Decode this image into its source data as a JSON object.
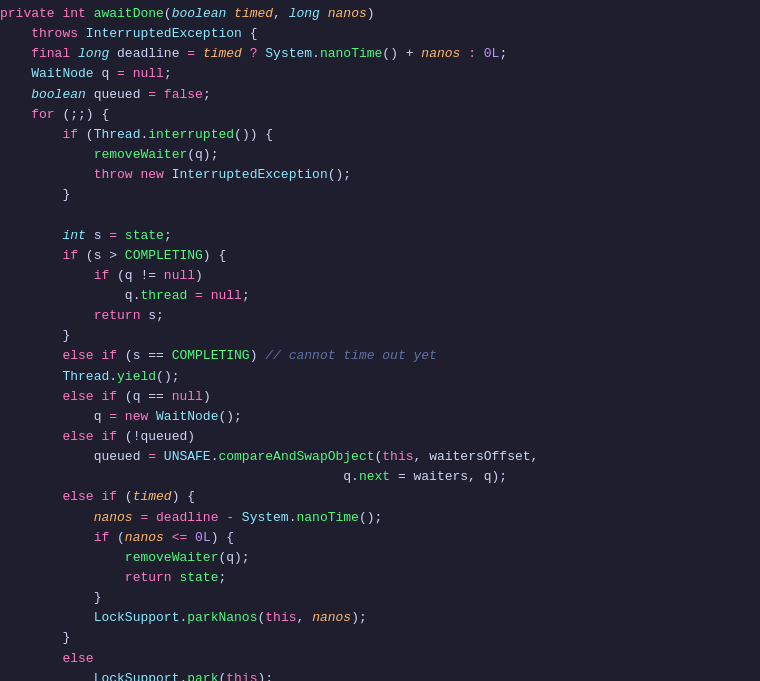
{
  "code": {
    "lines": [
      {
        "id": 1,
        "tokens": [
          {
            "text": "private ",
            "cls": "kw"
          },
          {
            "text": "int ",
            "cls": "kw"
          },
          {
            "text": "awaitDone",
            "cls": "method"
          },
          {
            "text": "(",
            "cls": "punct"
          },
          {
            "text": "boolean ",
            "cls": "type"
          },
          {
            "text": "timed",
            "cls": "param"
          },
          {
            "text": ", ",
            "cls": "punct"
          },
          {
            "text": "long ",
            "cls": "type"
          },
          {
            "text": "nanos",
            "cls": "param"
          },
          {
            "text": ")",
            "cls": "punct"
          }
        ]
      },
      {
        "id": 2,
        "tokens": [
          {
            "text": "    ",
            "cls": ""
          },
          {
            "text": "throws ",
            "cls": "kw2"
          },
          {
            "text": "InterruptedException",
            "cls": "class-name"
          },
          {
            "text": " {",
            "cls": "punct"
          }
        ]
      },
      {
        "id": 3,
        "tokens": [
          {
            "text": "    ",
            "cls": ""
          },
          {
            "text": "final ",
            "cls": "kw"
          },
          {
            "text": "long ",
            "cls": "type"
          },
          {
            "text": "deadline ",
            "cls": "var"
          },
          {
            "text": "= ",
            "cls": "op"
          },
          {
            "text": "timed",
            "cls": "param"
          },
          {
            "text": " ? ",
            "cls": "op"
          },
          {
            "text": "System",
            "cls": "class-name"
          },
          {
            "text": ".",
            "cls": "punct"
          },
          {
            "text": "nanoTime",
            "cls": "method"
          },
          {
            "text": "() + ",
            "cls": "punct"
          },
          {
            "text": "nanos",
            "cls": "param"
          },
          {
            "text": " : ",
            "cls": "op"
          },
          {
            "text": "0L",
            "cls": "num"
          },
          {
            "text": ";",
            "cls": "punct"
          }
        ]
      },
      {
        "id": 4,
        "tokens": [
          {
            "text": "    ",
            "cls": ""
          },
          {
            "text": "WaitNode ",
            "cls": "class-name"
          },
          {
            "text": "q ",
            "cls": "var"
          },
          {
            "text": "= ",
            "cls": "op"
          },
          {
            "text": "null",
            "cls": "kw"
          },
          {
            "text": ";",
            "cls": "punct"
          }
        ]
      },
      {
        "id": 5,
        "tokens": [
          {
            "text": "    ",
            "cls": ""
          },
          {
            "text": "boolean ",
            "cls": "type"
          },
          {
            "text": "queued ",
            "cls": "var"
          },
          {
            "text": "= ",
            "cls": "op"
          },
          {
            "text": "false",
            "cls": "kw"
          },
          {
            "text": ";",
            "cls": "punct"
          }
        ]
      },
      {
        "id": 6,
        "tokens": [
          {
            "text": "    ",
            "cls": ""
          },
          {
            "text": "for ",
            "cls": "kw2"
          },
          {
            "text": "(;;) {",
            "cls": "punct"
          }
        ]
      },
      {
        "id": 7,
        "tokens": [
          {
            "text": "        ",
            "cls": ""
          },
          {
            "text": "if ",
            "cls": "kw2"
          },
          {
            "text": "(",
            "cls": "punct"
          },
          {
            "text": "Thread",
            "cls": "class-name"
          },
          {
            "text": ".",
            "cls": "punct"
          },
          {
            "text": "interrupted",
            "cls": "method"
          },
          {
            "text": "()) {",
            "cls": "punct"
          }
        ]
      },
      {
        "id": 8,
        "tokens": [
          {
            "text": "            ",
            "cls": ""
          },
          {
            "text": "removeWaiter",
            "cls": "method"
          },
          {
            "text": "(q);",
            "cls": "punct"
          }
        ]
      },
      {
        "id": 9,
        "tokens": [
          {
            "text": "            ",
            "cls": ""
          },
          {
            "text": "throw ",
            "cls": "kw2"
          },
          {
            "text": "new ",
            "cls": "kw"
          },
          {
            "text": "InterruptedException",
            "cls": "class-name"
          },
          {
            "text": "();",
            "cls": "punct"
          }
        ]
      },
      {
        "id": 10,
        "tokens": [
          {
            "text": "        ",
            "cls": ""
          },
          {
            "text": "}",
            "cls": "punct"
          }
        ]
      },
      {
        "id": 11,
        "tokens": []
      },
      {
        "id": 12,
        "tokens": [
          {
            "text": "        ",
            "cls": ""
          },
          {
            "text": "int ",
            "cls": "type"
          },
          {
            "text": "s ",
            "cls": "var"
          },
          {
            "text": "= ",
            "cls": "op"
          },
          {
            "text": "state",
            "cls": "field"
          },
          {
            "text": ";",
            "cls": "punct"
          }
        ]
      },
      {
        "id": 13,
        "tokens": [
          {
            "text": "        ",
            "cls": ""
          },
          {
            "text": "if ",
            "cls": "kw2"
          },
          {
            "text": "(s > ",
            "cls": "punct"
          },
          {
            "text": "COMPLETING",
            "cls": "field"
          },
          {
            "text": ") {",
            "cls": "punct"
          }
        ]
      },
      {
        "id": 14,
        "tokens": [
          {
            "text": "            ",
            "cls": ""
          },
          {
            "text": "if ",
            "cls": "kw2"
          },
          {
            "text": "(q != ",
            "cls": "punct"
          },
          {
            "text": "null",
            "cls": "kw"
          },
          {
            "text": ")",
            "cls": "punct"
          }
        ]
      },
      {
        "id": 15,
        "tokens": [
          {
            "text": "                ",
            "cls": ""
          },
          {
            "text": "q",
            "cls": "var"
          },
          {
            "text": ".",
            "cls": "punct"
          },
          {
            "text": "thread ",
            "cls": "field"
          },
          {
            "text": "= ",
            "cls": "op"
          },
          {
            "text": "null",
            "cls": "kw"
          },
          {
            "text": ";",
            "cls": "punct"
          }
        ]
      },
      {
        "id": 16,
        "tokens": [
          {
            "text": "            ",
            "cls": ""
          },
          {
            "text": "return ",
            "cls": "kw2"
          },
          {
            "text": "s",
            "cls": "var"
          },
          {
            "text": ";",
            "cls": "punct"
          }
        ]
      },
      {
        "id": 17,
        "tokens": [
          {
            "text": "        ",
            "cls": ""
          },
          {
            "text": "}",
            "cls": "punct"
          }
        ]
      },
      {
        "id": 18,
        "tokens": [
          {
            "text": "        ",
            "cls": ""
          },
          {
            "text": "else ",
            "cls": "kw2"
          },
          {
            "text": "if ",
            "cls": "kw2"
          },
          {
            "text": "(s == ",
            "cls": "punct"
          },
          {
            "text": "COMPLETING",
            "cls": "field"
          },
          {
            "text": ") ",
            "cls": "punct"
          },
          {
            "text": "// cannot time out yet",
            "cls": "comment"
          }
        ]
      },
      {
        "id": 19,
        "tokens": [
          {
            "text": "    ",
            "cls": ""
          },
          {
            "text": "    ",
            "cls": ""
          },
          {
            "text": "Thread",
            "cls": "class-name"
          },
          {
            "text": ".",
            "cls": "punct"
          },
          {
            "text": "yield",
            "cls": "method"
          },
          {
            "text": "();",
            "cls": "punct"
          }
        ]
      },
      {
        "id": 20,
        "tokens": [
          {
            "text": "        ",
            "cls": ""
          },
          {
            "text": "else ",
            "cls": "kw2"
          },
          {
            "text": "if ",
            "cls": "kw2"
          },
          {
            "text": "(q == ",
            "cls": "punct"
          },
          {
            "text": "null",
            "cls": "kw"
          },
          {
            "text": ")",
            "cls": "punct"
          }
        ]
      },
      {
        "id": 21,
        "tokens": [
          {
            "text": "            ",
            "cls": ""
          },
          {
            "text": "q ",
            "cls": "var"
          },
          {
            "text": "= ",
            "cls": "op"
          },
          {
            "text": "new ",
            "cls": "kw"
          },
          {
            "text": "WaitNode",
            "cls": "class-name"
          },
          {
            "text": "();",
            "cls": "punct"
          }
        ]
      },
      {
        "id": 22,
        "tokens": [
          {
            "text": "        ",
            "cls": ""
          },
          {
            "text": "else ",
            "cls": "kw2"
          },
          {
            "text": "if ",
            "cls": "kw2"
          },
          {
            "text": "(!",
            "cls": "punct"
          },
          {
            "text": "queued",
            "cls": "var"
          },
          {
            "text": ")",
            "cls": "punct"
          }
        ]
      },
      {
        "id": 23,
        "tokens": [
          {
            "text": "            ",
            "cls": ""
          },
          {
            "text": "queued ",
            "cls": "var"
          },
          {
            "text": "= ",
            "cls": "op"
          },
          {
            "text": "UNSAFE",
            "cls": "class-name"
          },
          {
            "text": ".",
            "cls": "punct"
          },
          {
            "text": "compareAndSwapObject",
            "cls": "method"
          },
          {
            "text": "(",
            "cls": "punct"
          },
          {
            "text": "this",
            "cls": "kw"
          },
          {
            "text": ", waitersOffset,",
            "cls": "punct"
          }
        ]
      },
      {
        "id": 24,
        "tokens": [
          {
            "text": "                                            ",
            "cls": ""
          },
          {
            "text": "q",
            "cls": "var"
          },
          {
            "text": ".",
            "cls": "punct"
          },
          {
            "text": "next ",
            "cls": "field"
          },
          {
            "text": "= waiters, q);",
            "cls": "punct"
          }
        ]
      },
      {
        "id": 25,
        "tokens": [
          {
            "text": "        ",
            "cls": ""
          },
          {
            "text": "else ",
            "cls": "kw2"
          },
          {
            "text": "if ",
            "cls": "kw2"
          },
          {
            "text": "(",
            "cls": "punct"
          },
          {
            "text": "timed",
            "cls": "param"
          },
          {
            "text": ") {",
            "cls": "punct"
          }
        ]
      },
      {
        "id": 26,
        "tokens": [
          {
            "text": "            ",
            "cls": ""
          },
          {
            "text": "nanos ",
            "cls": "param"
          },
          {
            "text": "= deadline - ",
            "cls": "op"
          },
          {
            "text": "System",
            "cls": "class-name"
          },
          {
            "text": ".",
            "cls": "punct"
          },
          {
            "text": "nanoTime",
            "cls": "method"
          },
          {
            "text": "();",
            "cls": "punct"
          }
        ]
      },
      {
        "id": 27,
        "tokens": [
          {
            "text": "            ",
            "cls": ""
          },
          {
            "text": "if ",
            "cls": "kw2"
          },
          {
            "text": "(",
            "cls": "punct"
          },
          {
            "text": "nanos",
            "cls": "param"
          },
          {
            "text": " <= ",
            "cls": "op"
          },
          {
            "text": "0L",
            "cls": "num"
          },
          {
            "text": ") {",
            "cls": "punct"
          }
        ]
      },
      {
        "id": 28,
        "tokens": [
          {
            "text": "                ",
            "cls": ""
          },
          {
            "text": "removeWaiter",
            "cls": "method"
          },
          {
            "text": "(q);",
            "cls": "punct"
          }
        ]
      },
      {
        "id": 29,
        "tokens": [
          {
            "text": "                ",
            "cls": ""
          },
          {
            "text": "return ",
            "cls": "kw2"
          },
          {
            "text": "state",
            "cls": "field"
          },
          {
            "text": ";",
            "cls": "punct"
          }
        ]
      },
      {
        "id": 30,
        "tokens": [
          {
            "text": "            ",
            "cls": ""
          },
          {
            "text": "}",
            "cls": "punct"
          }
        ]
      },
      {
        "id": 31,
        "tokens": [
          {
            "text": "            ",
            "cls": ""
          },
          {
            "text": "LockSupport",
            "cls": "class-name"
          },
          {
            "text": ".",
            "cls": "punct"
          },
          {
            "text": "parkNanos",
            "cls": "method"
          },
          {
            "text": "(",
            "cls": "punct"
          },
          {
            "text": "this",
            "cls": "kw"
          },
          {
            "text": ", ",
            "cls": "punct"
          },
          {
            "text": "nanos",
            "cls": "param"
          },
          {
            "text": ");",
            "cls": "punct"
          }
        ]
      },
      {
        "id": 32,
        "tokens": [
          {
            "text": "        ",
            "cls": ""
          },
          {
            "text": "}",
            "cls": "punct"
          }
        ]
      },
      {
        "id": 33,
        "tokens": [
          {
            "text": "        ",
            "cls": ""
          },
          {
            "text": "else",
            "cls": "kw2"
          }
        ]
      },
      {
        "id": 34,
        "tokens": [
          {
            "text": "            ",
            "cls": ""
          },
          {
            "text": "LockSupport",
            "cls": "class-name"
          },
          {
            "text": ".",
            "cls": "punct"
          },
          {
            "text": "park",
            "cls": "method"
          },
          {
            "text": "(",
            "cls": "punct"
          },
          {
            "text": "this",
            "cls": "kw"
          },
          {
            "text": ");",
            "cls": "punct"
          }
        ]
      }
    ]
  }
}
